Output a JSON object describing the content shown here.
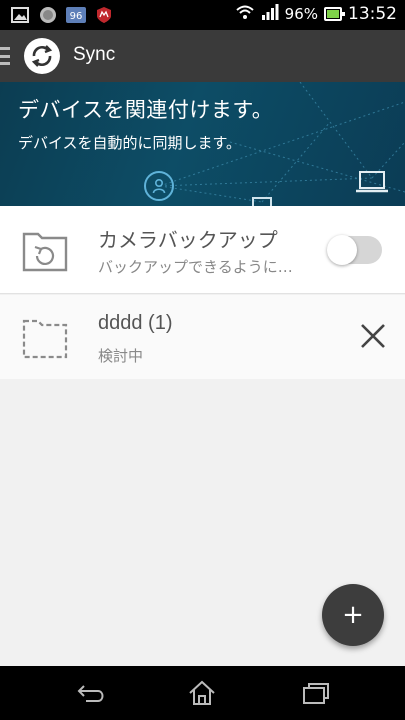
{
  "status_bar": {
    "battery_percent": "96%",
    "battery_level": 0.96,
    "time": "13:52",
    "notification_icons": [
      "image-icon",
      "globe-icon",
      "data-usage-icon",
      "mcafee-icon"
    ],
    "data_usage_label": "96"
  },
  "app_bar": {
    "title": "Sync"
  },
  "banner": {
    "title": "デバイスを関連付けます。",
    "subtitle": "デバイスを自動的に同期します。"
  },
  "list": {
    "camera_backup": {
      "title": "カメラバックアップ",
      "subtitle": "バックアップできるように…",
      "toggle_on": false
    },
    "folder": {
      "title": "dddd (1)",
      "subtitle": "検討中"
    }
  },
  "fab": {
    "label": "+"
  },
  "colors": {
    "app_bar": "#3a3a3a",
    "banner": "#0d4d66",
    "accent": "#5fb3d9",
    "background": "#f1f1f1"
  }
}
